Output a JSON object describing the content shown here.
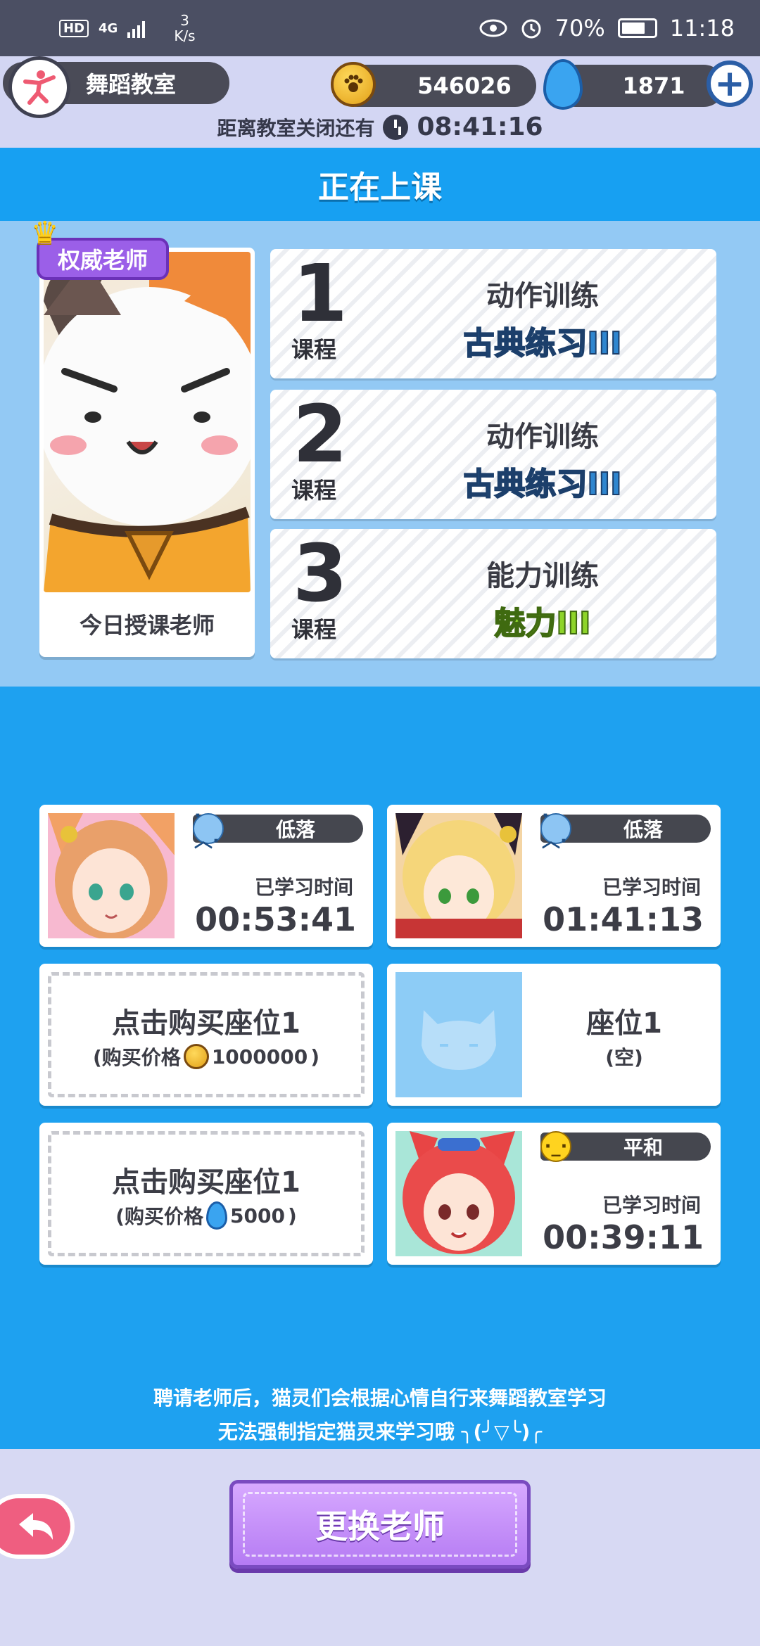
{
  "status_bar": {
    "hd": "HD",
    "net_type": "4G",
    "speed_value": "3",
    "speed_unit": "K/s",
    "battery": "70%",
    "time": "11:18"
  },
  "header": {
    "room_title": "舞蹈教室",
    "gold": "546026",
    "gems": "1871",
    "plus": "+",
    "closing_label": "距离教室关闭还有",
    "closing_time": "08:41:16"
  },
  "class": {
    "title": "正在上课",
    "teacher_badge": "权威老师",
    "teacher_caption": "今日授课老师",
    "courses": [
      {
        "num": "1",
        "label": "课程",
        "type": "动作训练",
        "name": "古典练习III",
        "color": "blue"
      },
      {
        "num": "2",
        "label": "课程",
        "type": "动作训练",
        "name": "古典练习III",
        "color": "blue"
      },
      {
        "num": "3",
        "label": "课程",
        "type": "能力训练",
        "name": "魅力III",
        "color": "green"
      }
    ]
  },
  "seats": {
    "study_label": "已学习时间",
    "seat_a": {
      "mood": "低落",
      "time": "00:53:41"
    },
    "seat_b": {
      "mood": "低落",
      "time": "01:41:13"
    },
    "buy_1": {
      "title": "点击购买座位1",
      "price_prefix": "(购买价格",
      "price": "1000000",
      "price_suffix": ")"
    },
    "empty": {
      "title": "座位1",
      "sub": "(空)"
    },
    "buy_2": {
      "title": "点击购买座位1",
      "price_prefix": "(购买价格",
      "price": "5000",
      "price_suffix": ")"
    },
    "seat_c": {
      "mood": "平和",
      "time": "00:39:11"
    }
  },
  "hint": {
    "line1": "聘请老师后，猫灵们会根据心情自行来舞蹈教室学习",
    "line2": "无法强制指定猫灵来学习哦 ╮(╯▽╰)╭"
  },
  "footer": {
    "change_teacher": "更换老师"
  },
  "colors": {
    "title_blue": "#17a0f2",
    "panel_blue": "#93c9f4",
    "badge_purple": "#9b5fe8",
    "back_pink": "#ef5e80"
  }
}
